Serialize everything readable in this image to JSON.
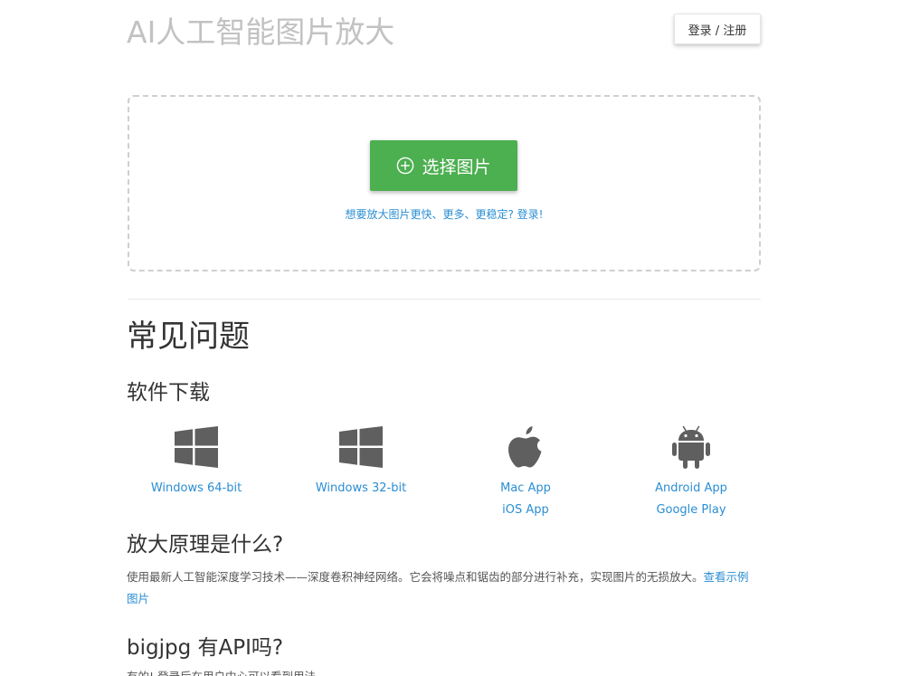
{
  "header": {
    "title": "AI人工智能图片放大",
    "login_label": "登录 / 注册"
  },
  "upload": {
    "button_label": "选择图片",
    "upsell_link": "想要放大图片更快、更多、更稳定? 登录!"
  },
  "faq": {
    "title": "常见问题",
    "download": {
      "heading": "软件下载",
      "items": [
        {
          "icon": "windows-icon",
          "links": [
            "Windows 64-bit"
          ]
        },
        {
          "icon": "windows-icon",
          "links": [
            "Windows 32-bit"
          ]
        },
        {
          "icon": "apple-icon",
          "links": [
            "Mac App",
            "iOS App"
          ]
        },
        {
          "icon": "android-icon",
          "links": [
            "Android App",
            "Google Play"
          ]
        }
      ]
    },
    "principle": {
      "heading": "放大原理是什么?",
      "text": "使用最新人工智能深度学习技术——深度卷积神经网络。它会将噪点和锯齿的部分进行补充，实现图片的无损放大。",
      "link": "查看示例图片"
    },
    "api": {
      "heading": "bigjpg 有API吗?",
      "text": "有的! 登录后在用户中心可以看到用法。"
    }
  },
  "colors": {
    "accent_green": "#4caf50",
    "link_blue": "#2b8ed3",
    "title_gray": "#c2c2c2",
    "icon_gray": "#5f5f5f"
  }
}
